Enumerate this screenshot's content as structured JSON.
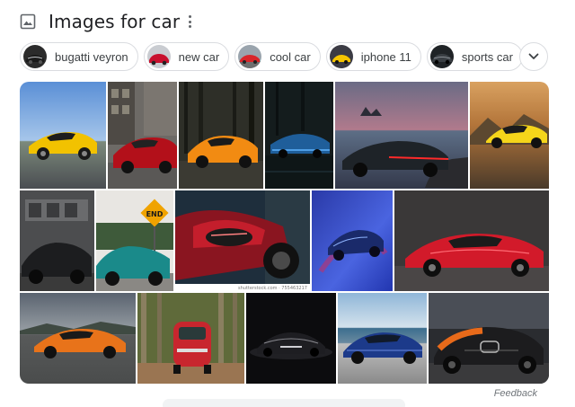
{
  "header": {
    "icon": "image-icon",
    "title": "Images for car",
    "more_icon": "more-vert-icon"
  },
  "chips": [
    {
      "label": "bugatti veyron",
      "thumb": "dark-hypercar"
    },
    {
      "label": "new car",
      "thumb": "red-car"
    },
    {
      "label": "cool car",
      "thumb": "red-sports-car"
    },
    {
      "label": "iphone 11",
      "thumb": "yellow-car"
    },
    {
      "label": "sports car",
      "thumb": "dark-sports-car"
    }
  ],
  "chips_more_icon": "chevron-down-icon",
  "images": [
    {
      "alt": "yellow Mercedes AMG GT on road"
    },
    {
      "alt": "red Audi R8 on city street"
    },
    {
      "alt": "orange Lamborghini in forest"
    },
    {
      "alt": "blue car at night on wet road"
    },
    {
      "alt": "dark concept car at seaside"
    },
    {
      "alt": "yellow sports car on dirt road"
    },
    {
      "alt": "black Lamborghini in garage"
    },
    {
      "alt": "teal Porsche near END road sign"
    },
    {
      "alt": "red car headlight close-up"
    },
    {
      "alt": "blue concept car on blue background"
    },
    {
      "alt": "red Corvette C8"
    },
    {
      "alt": "orange Corvette on track"
    },
    {
      "alt": "red Fiat 500 in forest"
    },
    {
      "alt": "black Bugatti La Voiture Noire"
    },
    {
      "alt": "blue Audi on coastal road"
    },
    {
      "alt": "black and orange Bugatti Chiron"
    }
  ],
  "end_sign_text": "END",
  "watermark": "shutterstock.com · 755463217",
  "feedback_label": "Feedback"
}
